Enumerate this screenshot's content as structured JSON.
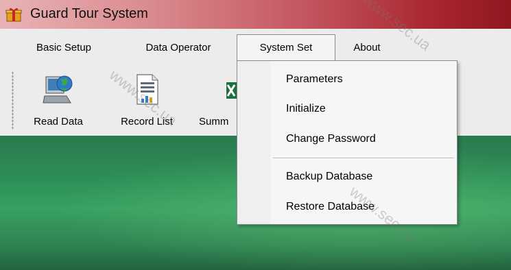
{
  "window": {
    "title": "Guard Tour System",
    "icon": "gift-box-icon"
  },
  "menubar": {
    "items": [
      {
        "label": "Basic Setup"
      },
      {
        "label": "Data Operator"
      },
      {
        "label": "System Set",
        "active": true
      },
      {
        "label": "About"
      }
    ]
  },
  "toolbar": {
    "buttons": [
      {
        "label": "Read Data",
        "icon": "computer-globe-icon"
      },
      {
        "label": "Record List",
        "icon": "document-chart-icon"
      },
      {
        "label": "Summ",
        "icon": "excel-icon"
      }
    ]
  },
  "dropdown": {
    "items": [
      {
        "label": "Parameters"
      },
      {
        "label": "Initialize"
      },
      {
        "label": "Change Password"
      },
      {
        "label": "Backup Database"
      },
      {
        "label": "Restore Database"
      }
    ]
  },
  "watermark": {
    "text": "www.sec.ua"
  },
  "colors": {
    "titlebar_end": "#8e1720",
    "desktop_green": "#2c8d57",
    "menu_bg": "#ececec"
  }
}
